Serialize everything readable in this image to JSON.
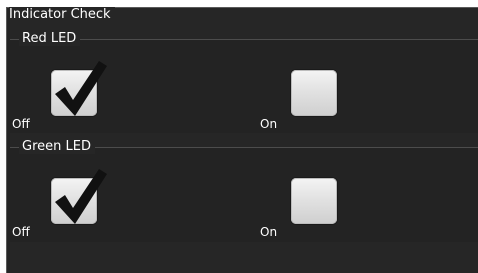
{
  "panel": {
    "title": "Indicator Check"
  },
  "groups": [
    {
      "title": "Red LED",
      "off_label": "Off",
      "on_label": "On",
      "off_checked": true,
      "on_checked": false
    },
    {
      "title": "Green LED",
      "off_label": "Off",
      "on_label": "On",
      "off_checked": true,
      "on_checked": false
    }
  ]
}
